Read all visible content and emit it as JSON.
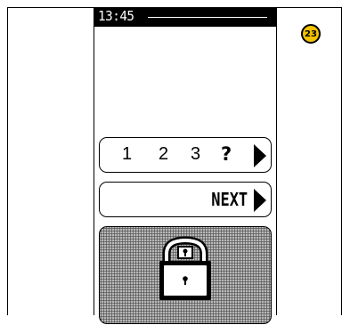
{
  "status": {
    "time": "13:45"
  },
  "step_badge": "23",
  "digit_row": {
    "digits": [
      "1",
      "2",
      "3"
    ],
    "placeholder": "?",
    "arrow_icon": "arrow-right-icon"
  },
  "next_row": {
    "label": "NEXT",
    "arrow_icon": "arrow-right-icon"
  },
  "lock_panel": {
    "icon": "padlock-icon"
  },
  "colors": {
    "badge": "#f2c200",
    "status_bar": "#000000",
    "panel": "#8d8d8d"
  }
}
